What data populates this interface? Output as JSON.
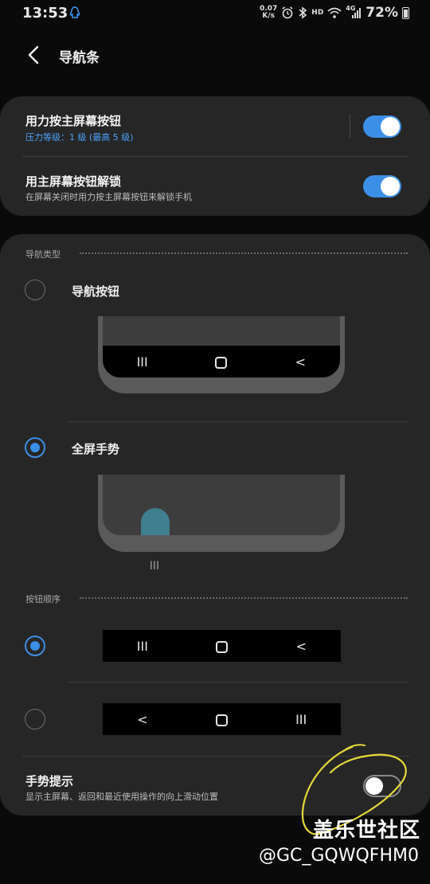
{
  "status_bar": {
    "time": "13:53",
    "net_speed_value": "0.07",
    "net_speed_unit": "K/s",
    "hd_label": "HD",
    "network_label": "4G",
    "battery_pct": "72%"
  },
  "header": {
    "title": "导航条"
  },
  "press_card": {
    "press_home": {
      "title": "用力按主屏幕按钮",
      "subtitle": "压力等级：1 级 (最高 5 级)",
      "enabled": true
    },
    "unlock": {
      "title": "用主屏幕按钮解锁",
      "subtitle": "在屏幕关闭时用力按主屏幕按钮来解锁手机",
      "enabled": true
    }
  },
  "nav_type": {
    "section_label": "导航类型",
    "options": [
      {
        "label": "导航按钮",
        "selected": false
      },
      {
        "label": "全屏手势",
        "selected": true
      }
    ],
    "preview_glyphs": [
      "III",
      "O",
      "<"
    ],
    "gesture_handle_glyph": "III"
  },
  "button_order": {
    "section_label": "按钮顺序",
    "options": [
      {
        "glyphs": [
          "III",
          "O",
          "<"
        ],
        "selected": true
      },
      {
        "glyphs": [
          "<",
          "O",
          "III"
        ],
        "selected": false
      }
    ]
  },
  "gesture_hints": {
    "title": "手势提示",
    "subtitle": "显示主屏幕、返回和最近使用操作的向上滑动位置",
    "enabled": false
  },
  "watermark": {
    "site": "盖乐世社区",
    "user": "@GC_GQWQFHM0"
  },
  "colors": {
    "accent": "#3c8fe6",
    "card_bg": "#262626",
    "page_bg": "#0a0a0a",
    "annotation": "#e6d93a"
  }
}
